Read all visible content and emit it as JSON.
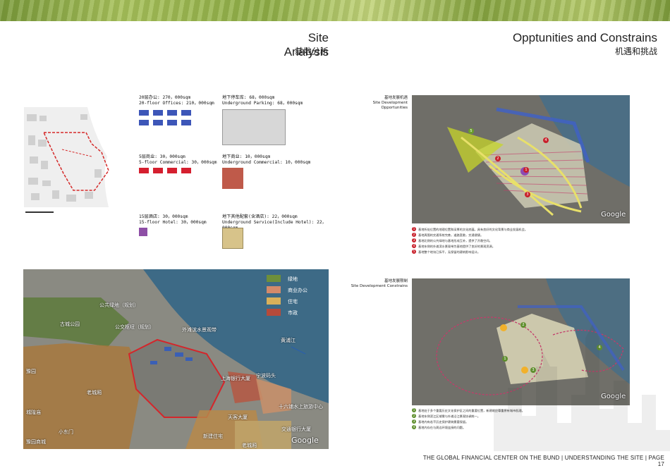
{
  "left_page": {
    "title_en": "Site Analysis",
    "title_cn": "基地分析",
    "office": {
      "cn": "20层办公: 270，000sqm",
      "en": "20-floor Offices: 210，000sqm"
    },
    "parking": {
      "cn": "地下停车库: 68，000sqm",
      "en": "Underground Parking: 68，000sqm"
    },
    "commercial": {
      "cn": "5层商业: 30，000sqm",
      "en": "5-floor Commercial: 30，000sqm"
    },
    "ug_commercial": {
      "cn": "地下商业: 10，000sqm",
      "en": "Underground Commercial: 10，000sqm"
    },
    "hotel": {
      "cn": "15层酒店: 30，000sqm",
      "en": "15-floor Hotel: 30，000sqm"
    },
    "ug_service": {
      "cn": "地下其他配套(含酒店): 22，000sqm",
      "en": "Underground Service(Include Hotel): 22，000sqm"
    },
    "aerial": {
      "legend": [
        "绿地",
        "商业办公",
        "住宅",
        "市政"
      ],
      "legend_colors": [
        "#6e8f3a",
        "#d38a6a",
        "#d9b05a",
        "#b64a3a"
      ],
      "labels": [
        "公共绿地（规划）",
        "古城公园",
        "公交枢纽（规划）",
        "外滩滨水景观带",
        "黄浦江",
        "豫园",
        "老城厢",
        "上海银行大厦",
        "宁波码头",
        "十六铺水上旅游中心",
        "天客大厦",
        "交通银行大厦",
        "新建住宅",
        "老城厢",
        "城隍庙",
        "豫园商城",
        "小东门"
      ],
      "watermark": "Google"
    }
  },
  "right_page": {
    "title_en": "Opptunities and Constrains",
    "title_cn": "机遇和挑战",
    "opp_caption_cn": "基地发展机遇",
    "opp_caption_en": "Site Development Opportunities",
    "opp_notes": [
      "基地所处位置的地理位置和深厚的文化底蕴，具有良好的文化背景与商业发展机会。",
      "基地周围的交通系统完善，道路宽敞，交通便捷。",
      "基地北侧的公共绿地与基地形成互补，提供了开敞空间。",
      "基地东侧的外滩滨水景观带为基地提供了良好的景观资源。",
      "基地整个地块已拆平，无保留的建筑影响设计。"
    ],
    "con_caption_cn": "基地发展限制",
    "con_caption_en": "Site Development Constrains",
    "con_notes": [
      "基地处于多个重要历史文化保护区之间的重要位置，新建筑应尊重原有城市肌理。",
      "基地东侧滨江区域需与外滩沿江景观协调统一。",
      "基地内有若干历史保护建筑需要保留。",
      "基地内存在与周边环境连接的问题。"
    ],
    "watermark": "Google"
  },
  "footer": "THE GLOBAL FINANCIAL CENTER ON THE BUND  |  UNDERSTANDING THE SITE  |  PAGE 17"
}
